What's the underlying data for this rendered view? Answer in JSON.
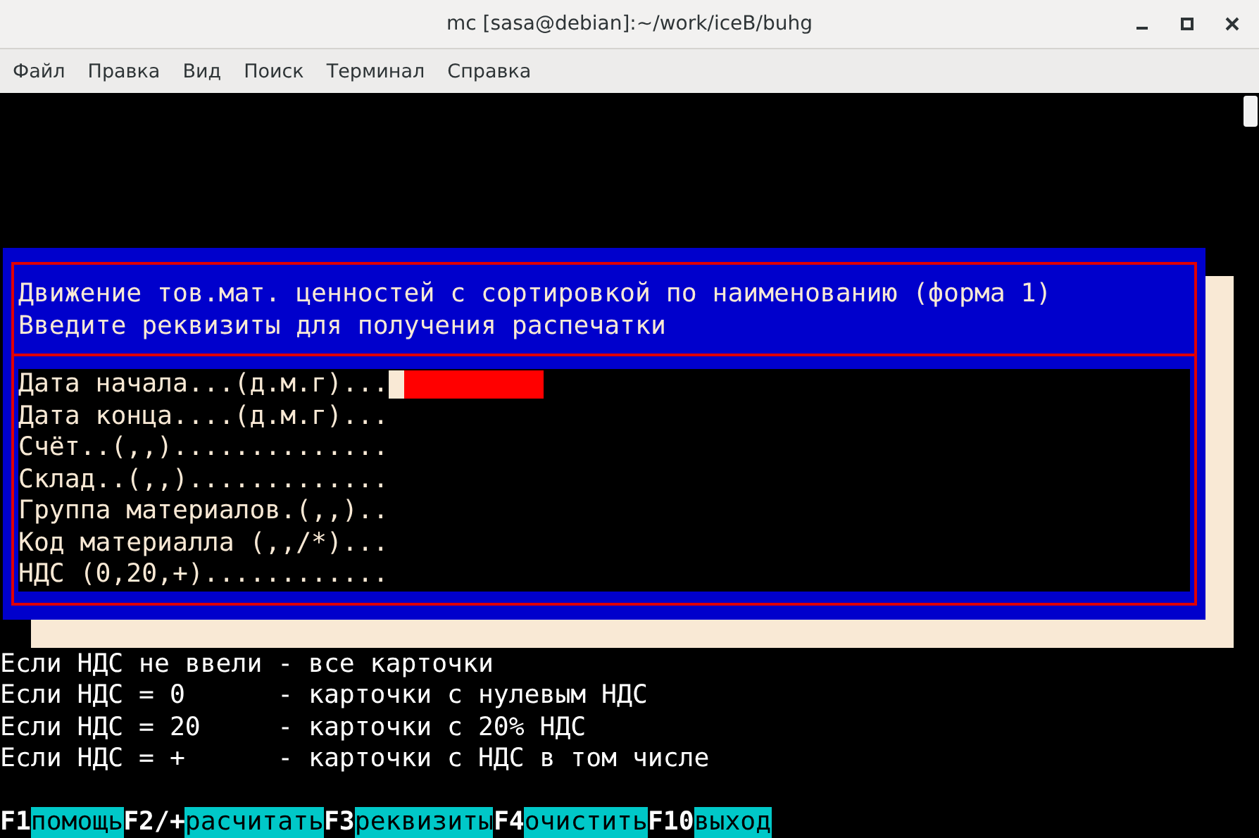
{
  "window": {
    "title": "mc [sasa@debian]:~/work/iceB/buhg"
  },
  "menu": [
    "Файл",
    "Правка",
    "Вид",
    "Поиск",
    "Терминал",
    "Справка"
  ],
  "dialog": {
    "title_lines": [
      "Движение тов.мат. ценностей с сортировкой по наименованию (форма 1)",
      "Введите реквизиты для получения распечатки"
    ],
    "fields": [
      {
        "label": "Дата начала...(д.м.г)...",
        "focused": true
      },
      {
        "label": "Дата конца....(д.м.г)...",
        "focused": false
      },
      {
        "label": "Счёт..(,,)..............",
        "focused": false
      },
      {
        "label": "Склад..(,,).............",
        "focused": false
      },
      {
        "label": "Группа материалов.(,,)..",
        "focused": false
      },
      {
        "label": "Код материалла (,,/*)...",
        "focused": false
      },
      {
        "label": "НДС (0,20,+)............",
        "focused": false
      }
    ]
  },
  "hints": [
    "Если НДС не ввели - все карточки",
    "Если НДС = 0      - карточки с нулевым НДС",
    "Если НДС = 20     - карточки с 20% НДС",
    "Если НДС = +      - карточки с НДС в том числе"
  ],
  "function_keys": [
    {
      "key": "F1",
      "label": "помощь"
    },
    {
      "key": "F2/+",
      "label": "расчитать"
    },
    {
      "key": "F3",
      "label": "реквизиты"
    },
    {
      "key": "F4",
      "label": "очистить"
    },
    {
      "key": "F10",
      "label": "выход"
    }
  ]
}
